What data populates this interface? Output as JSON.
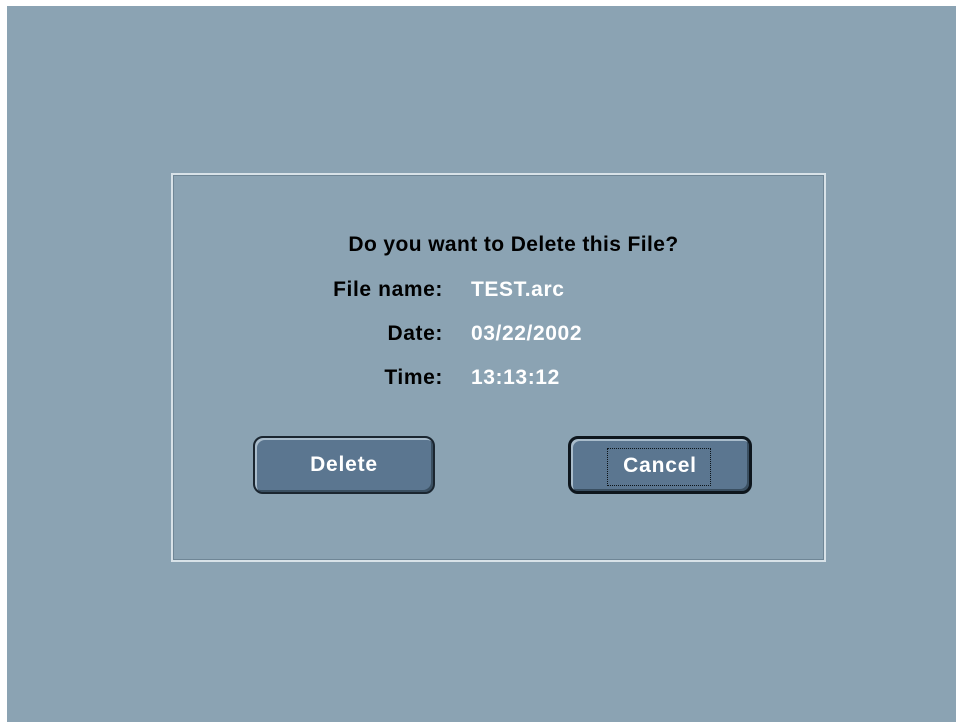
{
  "dialog": {
    "question": "Do you want to Delete this File?",
    "fields": {
      "file_name_label": "File name:",
      "file_name_value": "TEST.arc",
      "date_label": "Date:",
      "date_value": "03/22/2002",
      "time_label": "Time:",
      "time_value": "13:13:12"
    },
    "buttons": {
      "delete_label": "Delete",
      "cancel_label": "Cancel"
    }
  },
  "colors": {
    "background": "#8ba3b3",
    "button": "#5b7690",
    "value_text": "#ffffff",
    "label_text": "#000000"
  }
}
